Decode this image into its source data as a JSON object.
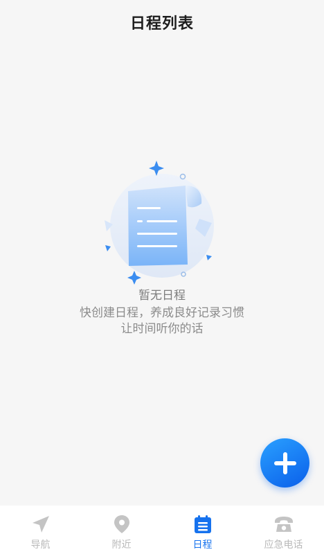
{
  "header": {
    "title": "日程列表"
  },
  "empty_state": {
    "title": "暂无日程",
    "line1": "快创建日程，养成良好记录习惯",
    "line2": "让时间听你的话"
  },
  "fab": {
    "icon": "plus-icon"
  },
  "tabs": [
    {
      "label": "导航",
      "icon": "navigation-arrow-icon",
      "active": false
    },
    {
      "label": "附近",
      "icon": "location-pin-icon",
      "active": false
    },
    {
      "label": "日程",
      "icon": "calendar-list-icon",
      "active": true
    },
    {
      "label": "应急电话",
      "icon": "telephone-icon",
      "active": false
    }
  ],
  "colors": {
    "accent": "#1672ee",
    "inactive": "#b9b9b9",
    "background": "#f6f6f6"
  }
}
